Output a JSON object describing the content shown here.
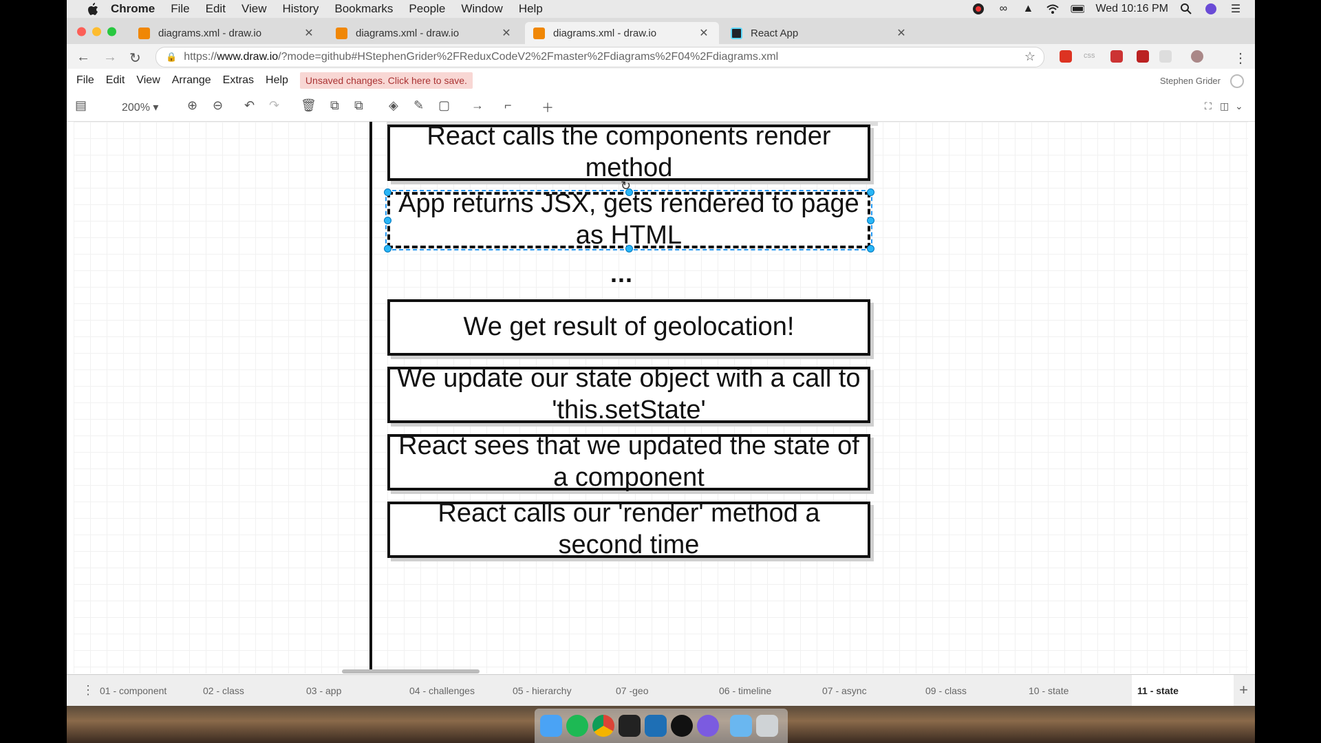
{
  "menubar": {
    "app_name": "Chrome",
    "items": [
      "File",
      "Edit",
      "View",
      "History",
      "Bookmarks",
      "People",
      "Window",
      "Help"
    ],
    "clock": "Wed 10:16 PM"
  },
  "tabs": [
    {
      "title": "diagrams.xml - draw.io",
      "active": false
    },
    {
      "title": "diagrams.xml - draw.io",
      "active": false
    },
    {
      "title": "diagrams.xml - draw.io",
      "active": true
    },
    {
      "title": "React App",
      "active": false
    }
  ],
  "address": {
    "url_prefix": "https://",
    "url_host": "www.draw.io",
    "url_rest": "/?mode=github#HStephenGrider%2FReduxCodeV2%2Fmaster%2Fdiagrams%2F04%2Fdiagrams.xml"
  },
  "app_menu": {
    "items": [
      "File",
      "Edit",
      "View",
      "Arrange",
      "Extras",
      "Help"
    ],
    "unsaved_notice": "Unsaved changes. Click here to save.",
    "user": "Stephen Grider"
  },
  "toolbar": {
    "zoom": "200%"
  },
  "diagram": {
    "boxes": [
      "React calls the components render method",
      "App returns JSX, gets rendered to page as HTML",
      "We get result of geolocation!",
      "We update our state object with a call to 'this.setState'",
      "React sees that we updated the state of a component",
      "React calls our 'render' method a second time"
    ],
    "ellipsis": "...",
    "selected_index": 1
  },
  "pages": [
    "01 - component",
    "02 - class",
    "03 - app",
    "04 - challenges",
    "05 - hierarchy",
    "07 -geo",
    "06 - timeline",
    "07 - async",
    "09 - class",
    "10 - state",
    "11 - state"
  ],
  "active_page": "11 - state",
  "colors": {
    "unsaved_bg": "#f8d7d4",
    "selection": "#29b6f6",
    "box_border": "#111111"
  }
}
